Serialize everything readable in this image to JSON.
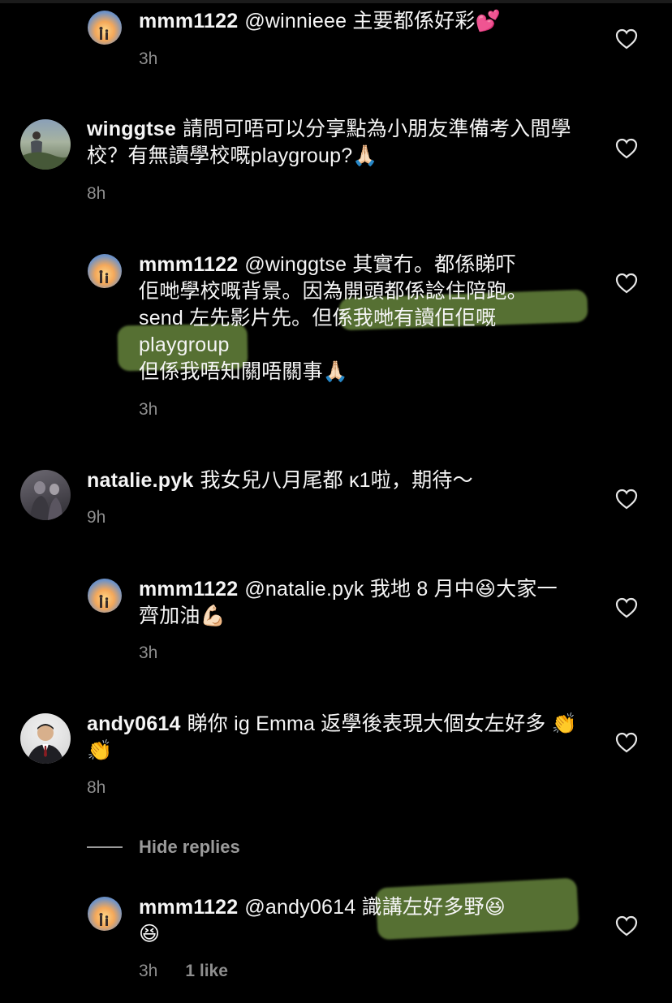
{
  "comments": [
    {
      "username": "mmm1122",
      "text": "@winnieee 主要都係好彩💕",
      "time": "3h"
    },
    {
      "username": "winggtse",
      "text": "請問可唔可以分享點為小朋友準備考入間學校？有無讀學校嘅playgroup?🙏🏻",
      "time": "8h"
    },
    {
      "username": "mmm1122",
      "text_line1": "@winggtse 其實冇。都係睇吓",
      "text_line2": "佢哋學校嘅背景。因為開頭都係諗住陪跑。",
      "text_line3a": "send 左先影片先。",
      "text_line3b": "但係我哋有讀佢佢嘅",
      "text_line4": "playgroup",
      "text_line5": "但係我唔知關唔關事🙏🏻",
      "time": "3h"
    },
    {
      "username": "natalie.pyk",
      "text": "我女兒八月尾都 κ1啦，期待～",
      "time": "9h"
    },
    {
      "username": "mmm1122",
      "text": "@natalie.pyk 我地 8 月中😆大家一齊加油💪🏻",
      "time": "3h"
    },
    {
      "username": "andy0614",
      "text": "睇你 ig Emma 返學後表現大個女左好多 👏👏",
      "time": "8h"
    },
    {
      "username": "mmm1122",
      "text_a": "@andy0614",
      "text_b": "識講左好多野😆",
      "text_c": "😆",
      "time": "3h",
      "likes": "1 like"
    }
  ],
  "hide_replies_label": "Hide replies",
  "icons": {
    "like": "heart-outline-icon",
    "avatar_style_mmm1122": "sunset-avatar"
  },
  "colors": {
    "background": "#000000",
    "text": "#f5f5f5",
    "meta": "#8e8e8e",
    "highlight": "#62803a"
  }
}
